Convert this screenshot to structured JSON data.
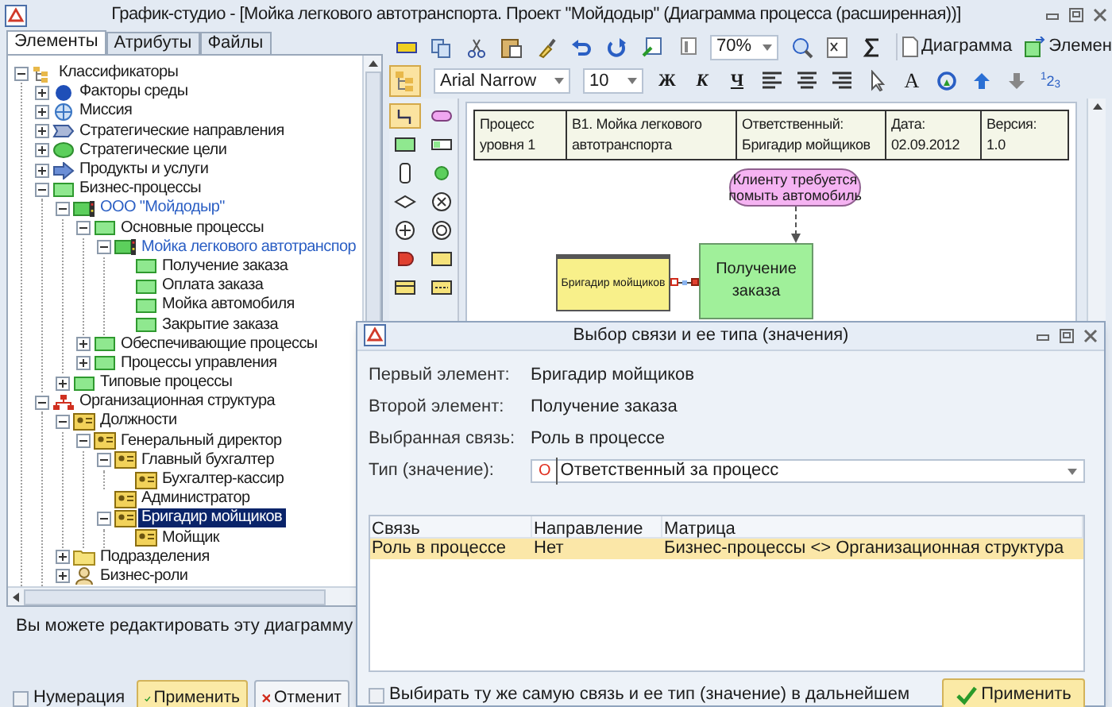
{
  "window": {
    "title": "График-студио - [Мойка легкового автотранспорта. Проект \"Мойдодыр\" (Диаграмма процесса (расширенная))]"
  },
  "left_panel": {
    "tabs": [
      {
        "label": "Элементы",
        "selected": true
      },
      {
        "label": "Атрибуты",
        "selected": false
      },
      {
        "label": "Файлы",
        "selected": false
      }
    ],
    "tree": [
      {
        "label": "Классификаторы",
        "kind": "classifier",
        "expanded": true,
        "children": [
          {
            "label": "Факторы среды",
            "kind": "factor",
            "expanded": false
          },
          {
            "label": "Миссия",
            "kind": "mission",
            "expanded": false
          },
          {
            "label": "Стратегические направления",
            "kind": "direction",
            "expanded": false
          },
          {
            "label": "Стратегические цели",
            "kind": "goal",
            "expanded": false
          },
          {
            "label": "Продукты и услуги",
            "kind": "product",
            "expanded": false
          },
          {
            "label": "Бизнес-процессы",
            "kind": "process",
            "expanded": true,
            "children": [
              {
                "label": "ООО \"Мойдодыр\"",
                "kind": "model",
                "expanded": true,
                "linked": true,
                "children": [
                  {
                    "label": "Основные процессы",
                    "kind": "process",
                    "expanded": true,
                    "children": [
                      {
                        "label": "Мойка легкового автотранспор",
                        "kind": "model",
                        "expanded": true,
                        "linked": true,
                        "children": [
                          {
                            "label": "Получение заказа",
                            "kind": "process"
                          },
                          {
                            "label": "Оплата заказа",
                            "kind": "process"
                          },
                          {
                            "label": "Мойка автомобиля",
                            "kind": "process"
                          },
                          {
                            "label": "Закрытие заказа",
                            "kind": "process"
                          }
                        ]
                      }
                    ]
                  },
                  {
                    "label": "Обеспечивающие процессы",
                    "kind": "process",
                    "expanded": false
                  },
                  {
                    "label": "Процессы управления",
                    "kind": "process",
                    "expanded": false
                  }
                ]
              },
              {
                "label": "Типовые процессы",
                "kind": "process",
                "expanded": false
              }
            ]
          },
          {
            "label": "Организационная структура",
            "kind": "org",
            "expanded": true,
            "children": [
              {
                "label": "Должности",
                "kind": "position",
                "expanded": true,
                "children": [
                  {
                    "label": "Генеральный директор",
                    "kind": "position",
                    "expanded": true,
                    "children": [
                      {
                        "label": "Главный бухгалтер",
                        "kind": "position",
                        "expanded": true,
                        "children": [
                          {
                            "label": "Бухгалтер-кассир",
                            "kind": "position"
                          }
                        ]
                      },
                      {
                        "label": "Администратор",
                        "kind": "position"
                      },
                      {
                        "label": "Бригадир мойщиков",
                        "kind": "position",
                        "expanded": true,
                        "selected": true,
                        "children": [
                          {
                            "label": "Мойщик",
                            "kind": "position"
                          }
                        ]
                      }
                    ]
                  }
                ]
              },
              {
                "label": "Подразделения",
                "kind": "folder",
                "expanded": false
              },
              {
                "label": "Бизнес-роли",
                "kind": "role",
                "expanded": false
              }
            ]
          }
        ]
      }
    ],
    "status": "Вы можете редактировать эту диаграмму",
    "numbering": {
      "label": "Нумерация",
      "checked": false
    },
    "buttons": [
      {
        "label": "Применить",
        "kind": "apply"
      },
      {
        "label": "Отменит",
        "kind": "cancel"
      }
    ]
  },
  "toolbar": {
    "zoom": "70%",
    "diagram_button": "Диаграмма",
    "element_button": "Элемен",
    "structure_toggle": {
      "on": true
    },
    "font": "Arial Narrow",
    "font_size": "10",
    "bold": "Ж",
    "italic": "К",
    "underline": "Ч",
    "text_style": "A",
    "numbering": "$^{1}$2$_{3}$"
  },
  "palette": [
    {
      "kind": "connector",
      "selected": true
    },
    {
      "kind": "event",
      "selected": false
    },
    {
      "kind": "process",
      "selected": false
    },
    {
      "kind": "small-rect",
      "selected": false
    },
    {
      "kind": "store",
      "selected": false
    },
    {
      "kind": "start",
      "selected": false
    },
    {
      "kind": "diamond",
      "selected": false
    },
    {
      "kind": "xor",
      "selected": false
    },
    {
      "kind": "and",
      "selected": false
    },
    {
      "kind": "end",
      "selected": false
    },
    {
      "kind": "delay",
      "selected": false
    },
    {
      "kind": "role",
      "selected": false
    },
    {
      "kind": "lane",
      "selected": false
    },
    {
      "kind": "document",
      "selected": false
    }
  ],
  "diagram": {
    "header": [
      {
        "lines": [
          "Процесс",
          "уровня 1"
        ]
      },
      {
        "lines": [
          "В1.  Мойка легкового",
          "автотранспорта"
        ]
      },
      {
        "lines": [
          "Ответственный:",
          "Бригадир мойщиков"
        ]
      },
      {
        "lines": [
          "Дата:",
          "02.09.2012"
        ]
      },
      {
        "lines": [
          "Версия:",
          "1.0"
        ]
      }
    ],
    "event": [
      "Клиенту требуется",
      "помыть автомобиль"
    ],
    "role": "Бригадир мойщиков",
    "process": [
      "Получение",
      "заказа"
    ]
  },
  "dialog": {
    "title": "Выбор связи и ее типа (значения)",
    "fields": [
      {
        "label": "Первый элемент:",
        "value": "Бригадир мойщиков"
      },
      {
        "label": "Второй элемент:",
        "value": "Получение заказа"
      },
      {
        "label": "Выбранная связь:",
        "value": "Роль в процессе"
      }
    ],
    "type": {
      "label": "Тип (значение):",
      "marker": "О",
      "value": "Ответственный за процесс"
    },
    "table": {
      "columns": [
        "Связь",
        "Направление",
        "Матрица"
      ],
      "rows": [
        {
          "cells": [
            "Роль в процессе",
            "Нет",
            "Бизнес-процессы <> Организационная структура"
          ],
          "selected": true
        }
      ]
    },
    "remember": {
      "label": "Выбирать ту же самую связь и ее тип (значение) в дальнейшем",
      "checked": false
    },
    "apply": "Применить"
  }
}
